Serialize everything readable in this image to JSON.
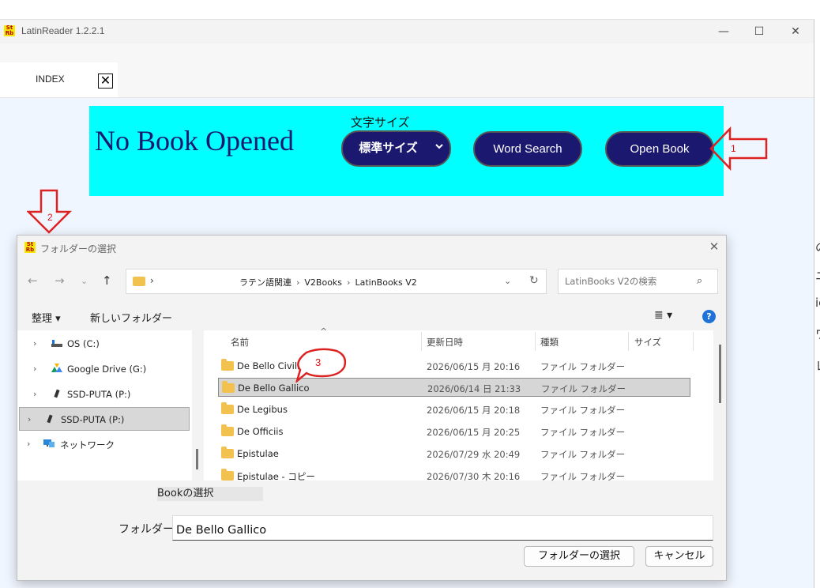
{
  "app": {
    "title": "LatinReader 1.2.2.1",
    "logo_text": "Sto\nRb",
    "window_controls": [
      "—",
      "☐",
      "✕"
    ]
  },
  "tab": {
    "label": "INDEX",
    "close_label": "✕"
  },
  "banner": {
    "status": "No Book Opened",
    "font_size_label": "文字サイズ",
    "font_size_value": "標準サイズ",
    "word_search_label": "Word Search",
    "open_book_label": "Open Book"
  },
  "dialog": {
    "title": "フォルダーの選択",
    "address": {
      "crumbs": [
        "ラテン語関連",
        "V2Books",
        "LatinBooks V2"
      ]
    },
    "search_placeholder": "LatinBooks V2の検索",
    "toolbar": {
      "organize": "整理 ▾",
      "new_folder": "新しいフォルダー"
    },
    "nav": [
      {
        "label": "OS (C:)",
        "icon": "drive-icon"
      },
      {
        "label": "Google Drive (G:)",
        "icon": "google-drive-icon"
      },
      {
        "label": "SSD-PUTA (P:)",
        "icon": "usb-drive-icon"
      },
      {
        "label": "SSD-PUTA (P:)",
        "icon": "usb-drive-icon",
        "selected": true
      },
      {
        "label": "ネットワーク",
        "icon": "network-icon"
      }
    ],
    "columns": [
      "名前",
      "更新日時",
      "種類",
      "サイズ"
    ],
    "files": [
      {
        "name": "De Bello Civili",
        "date": "2026/06/15 月 20:16",
        "type": "ファイル フォルダー"
      },
      {
        "name": "De Bello Gallico",
        "date": "2026/06/14 日 21:33",
        "type": "ファイル フォルダー",
        "selected": true
      },
      {
        "name": "De Legibus",
        "date": "2026/06/15 月 20:18",
        "type": "ファイル フォルダー"
      },
      {
        "name": "De Officiis",
        "date": "2026/06/15 月 20:25",
        "type": "ファイル フォルダー"
      },
      {
        "name": "Epistulae",
        "date": "2026/07/29 水 20:49",
        "type": "ファイル フォルダー"
      },
      {
        "name": "Epistulae - コピー",
        "date": "2026/07/30 木 20:16",
        "type": "ファイル フォルダー"
      }
    ],
    "book_select_label": "Bookの選択",
    "folder_label": "フォルダー:",
    "folder_value": "De Bello Gallico",
    "select_button": "フォルダーの選択",
    "cancel_button": "キャンセル"
  },
  "annotations": {
    "callout_1": "1",
    "callout_2": "2",
    "callout_3": "3",
    "color": "#dd2222"
  },
  "background_fragments": [
    "の",
    "ニ",
    "ic",
    "ワ",
    "レ"
  ],
  "colors": {
    "banner": "#00ffff",
    "button": "#1b1870",
    "accent": "#1f73d8"
  }
}
